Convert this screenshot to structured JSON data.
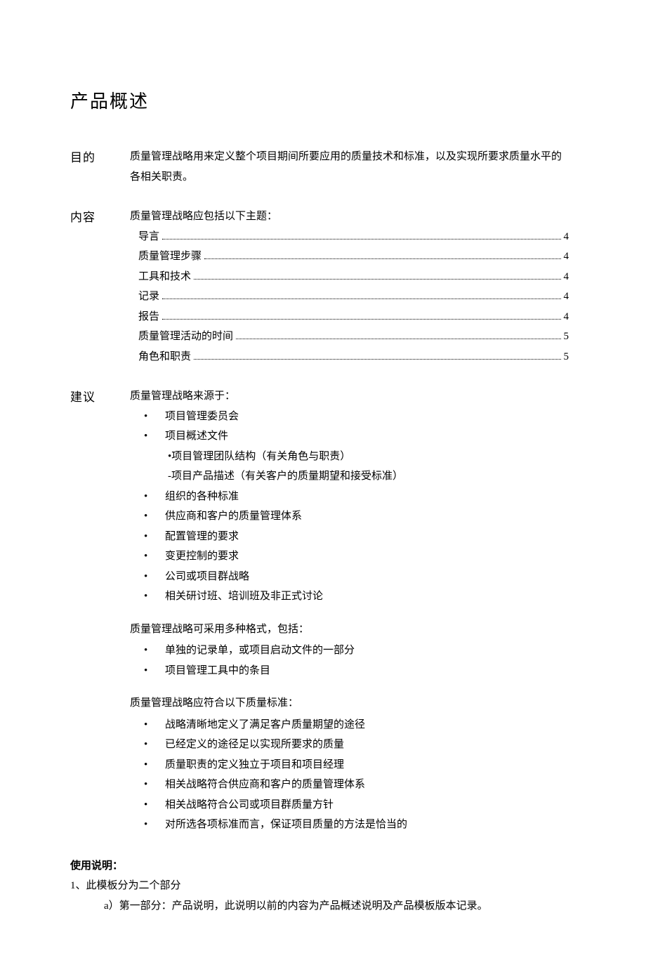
{
  "title": "产品概述",
  "purpose": {
    "label": "目的",
    "text": "质量管理战略用来定义整个项目期间所要应用的质量技术和标准，以及实现所要求质量水平的各相关职责。"
  },
  "contents": {
    "label": "内容",
    "intro": "质量管理战略应包括以下主题：",
    "toc": [
      {
        "label": "导言",
        "page": "4"
      },
      {
        "label": "质量管理步骤",
        "page": "4"
      },
      {
        "label": "工具和技术",
        "page": "4"
      },
      {
        "label": "记录",
        "page": "4"
      },
      {
        "label": "报告",
        "page": "4"
      },
      {
        "label": "质量管理活动的时间",
        "page": "5"
      },
      {
        "label": "角色和职责",
        "page": "5"
      }
    ]
  },
  "advice": {
    "label": "建议",
    "sourcesIntro": "质量管理战略来源于：",
    "sources": [
      "项目管理委员会",
      "项目概述文件",
      "组织的各种标准",
      "供应商和客户的质量管理体系",
      "配置管理的要求",
      "变更控制的要求",
      "公司或项目群战略",
      "相关研讨班、培训班及非正式讨论"
    ],
    "source1Sub1": "•项目管理团队结构（有关角色与职责）",
    "source1Sub2": "-项目产品描述（有关客户的质量期望和接受标准）",
    "formatsIntro": "质量管理战略可采用多种格式，包括：",
    "formats": [
      "单独的记录单，或项目启动文件的一部分",
      "项目管理工具中的条目"
    ],
    "standardsIntro": "质量管理战略应符合以下质量标准：",
    "standards": [
      "战略清晰地定义了满足客户质量期望的途径",
      "已经定义的途径足以实现所要求的质量",
      "质量职责的定义独立于项目和项目经理",
      "相关战略符合供应商和客户的质量管理体系",
      "相关战略符合公司或项目群质量方针",
      "对所选各项标准而言，保证项目质量的方法是恰当的"
    ]
  },
  "usage": {
    "title": "使用说明：",
    "line1": "1、此模板分为二个部分",
    "line1a": "a）第一部分：产品说明，此说明以前的内容为产品概述说明及产品模板版本记录。"
  }
}
